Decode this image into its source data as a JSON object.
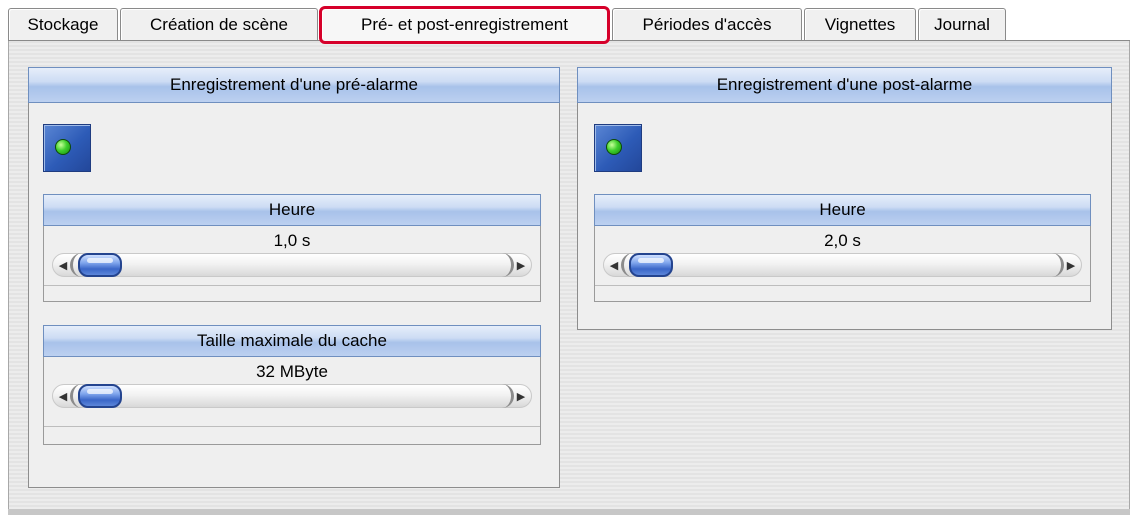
{
  "tabs": [
    {
      "label": "Stockage",
      "active": false
    },
    {
      "label": "Création de scène",
      "active": false
    },
    {
      "label": "Pré- et post-enregistrement",
      "active": true
    },
    {
      "label": "Périodes d'accès",
      "active": false
    },
    {
      "label": "Vignettes",
      "active": false
    },
    {
      "label": "Journal",
      "active": false
    }
  ],
  "pre_alarm": {
    "title": "Enregistrement d'une pré-alarme",
    "time": {
      "label": "Heure",
      "value": "1,0 s"
    },
    "cache": {
      "label": "Taille maximale du cache",
      "value": "32 MByte"
    }
  },
  "post_alarm": {
    "title": "Enregistrement d'une post-alarme",
    "time": {
      "label": "Heure",
      "value": "2,0 s"
    }
  },
  "icons": {
    "toggle": "green-led-icon",
    "slider_left": "arrow-left-icon",
    "slider_right": "arrow-right-icon"
  },
  "colors": {
    "active_tab_border": "#d6002a",
    "header_blue": "#a8c2ea",
    "led_green": "#3fcf2c",
    "button_blue": "#2d5bb7"
  }
}
